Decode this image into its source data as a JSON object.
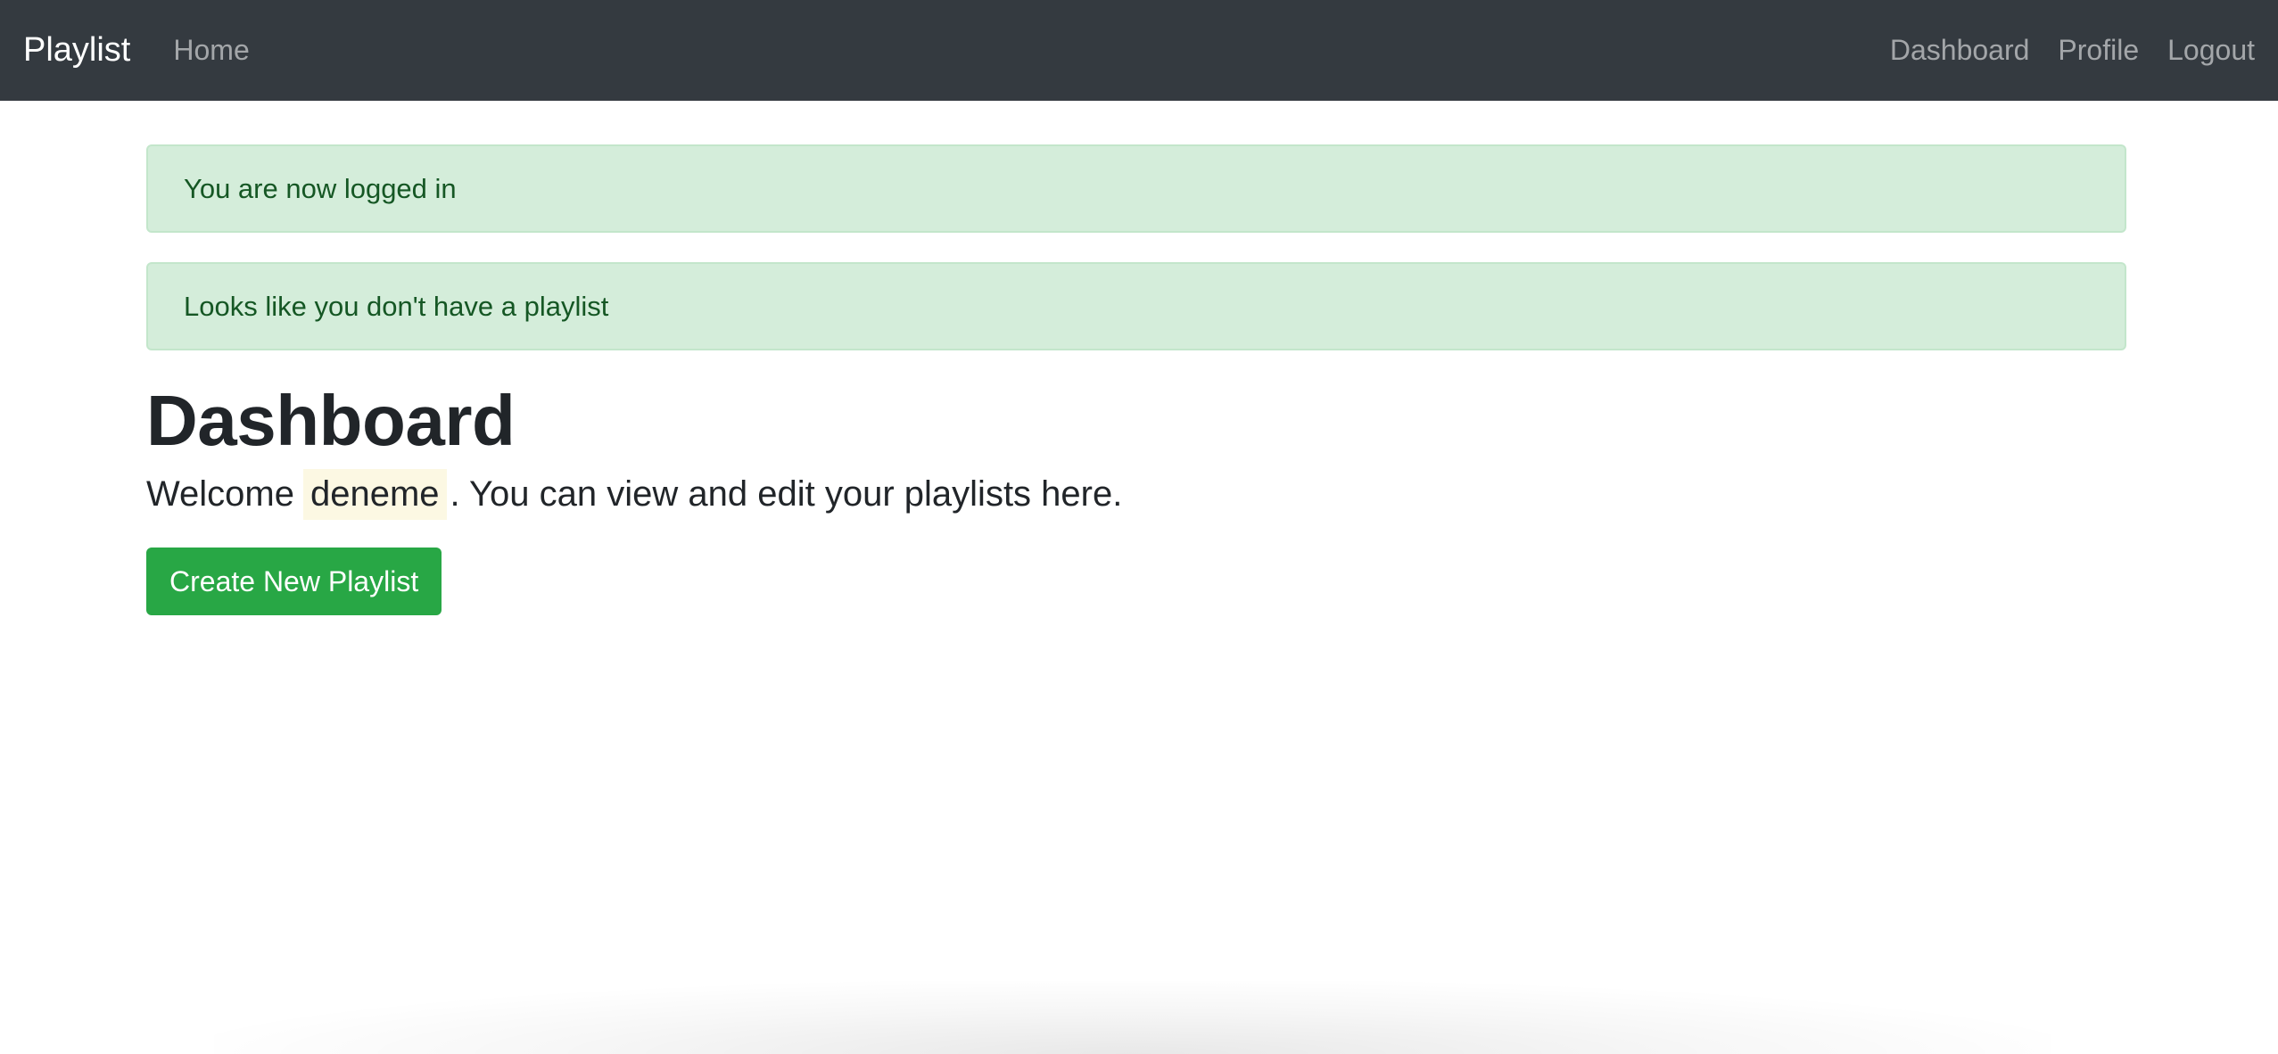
{
  "navbar": {
    "brand": "Playlist",
    "left_links": [
      "Home"
    ],
    "right_links": [
      "Dashboard",
      "Profile",
      "Logout"
    ]
  },
  "alerts": [
    "You are now logged in",
    "Looks like you don't have a playlist"
  ],
  "main": {
    "title": "Dashboard",
    "welcome_prefix": "Welcome",
    "username": "deneme",
    "welcome_suffix": ". You can view and edit your playlists here.",
    "create_button_label": "Create New Playlist"
  },
  "colors": {
    "navbar_bg": "#343a40",
    "alert_bg": "#d4edda",
    "alert_text": "#155724",
    "button_bg": "#28a745",
    "username_highlight": "#fcf8e3"
  }
}
